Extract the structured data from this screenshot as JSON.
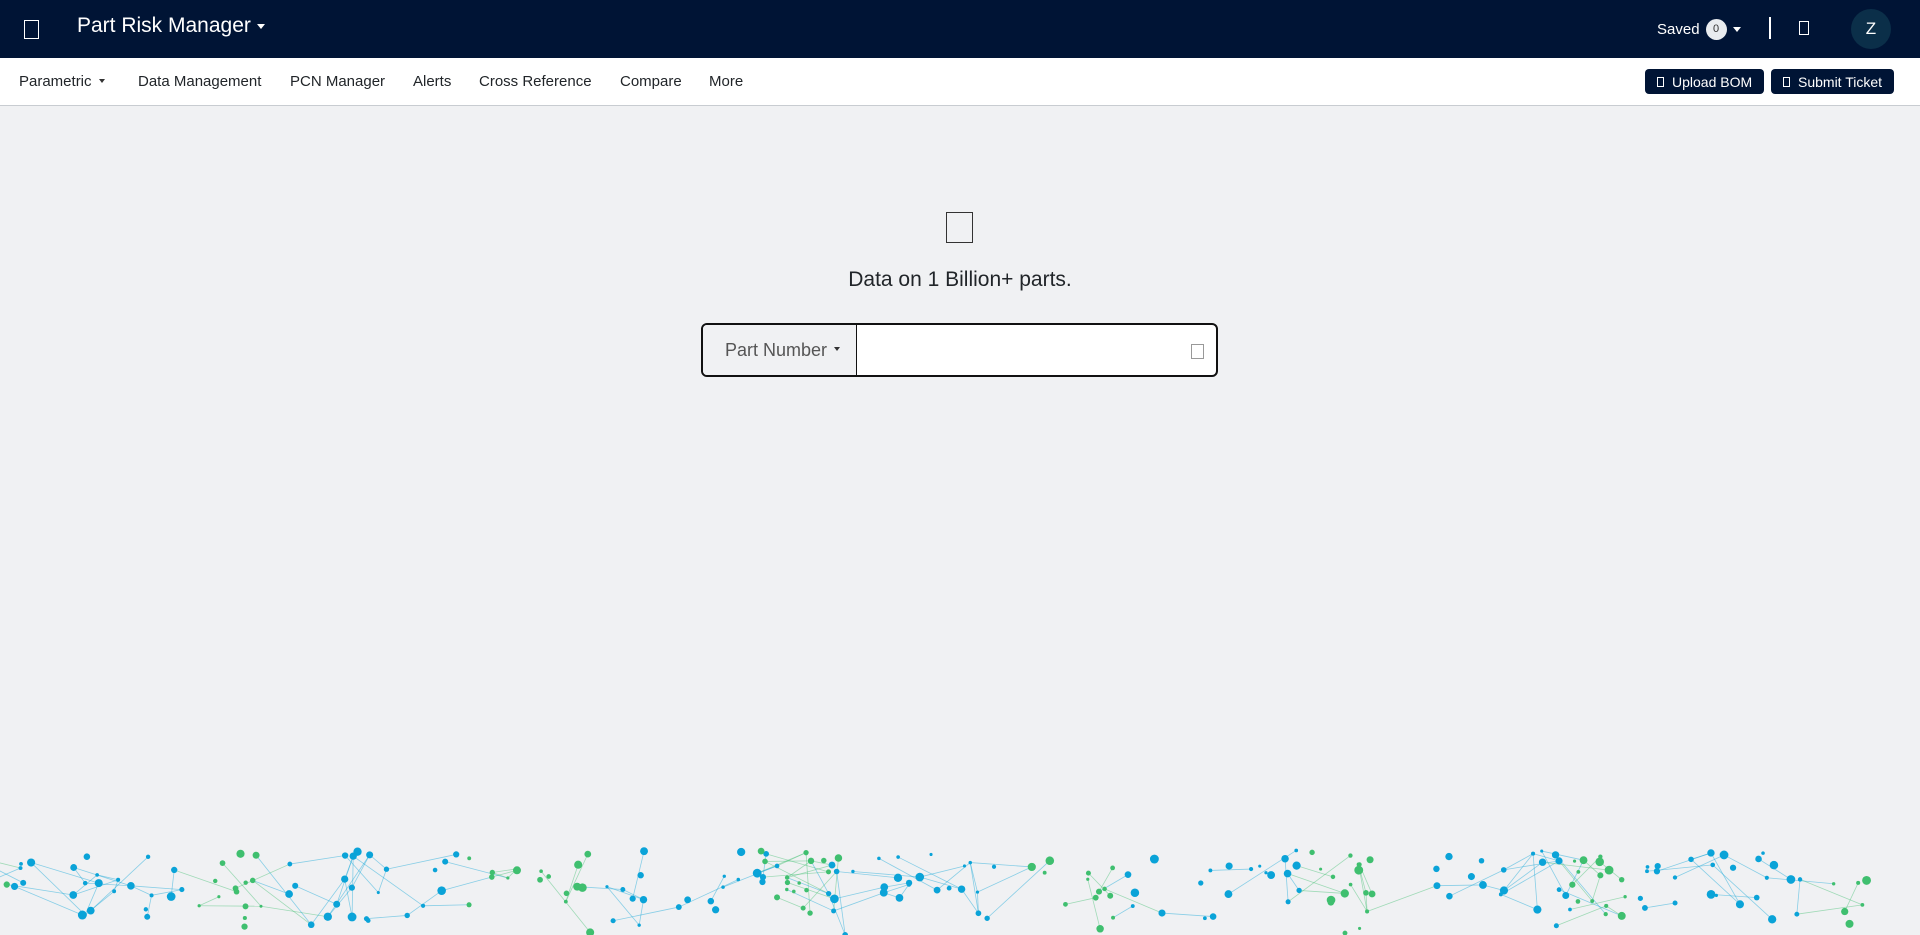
{
  "header": {
    "app_title": "Part Risk Manager",
    "saved_label": "Saved",
    "saved_count": "0",
    "avatar_initial": "Z"
  },
  "nav": {
    "items": [
      "Parametric",
      "Data Management",
      "PCN Manager",
      "Alerts",
      "Cross Reference",
      "Compare",
      "More"
    ],
    "upload_bom": "Upload BOM",
    "submit_ticket": "Submit Ticket"
  },
  "main": {
    "tagline": "Data on 1 Billion+ parts.",
    "search_type": "Part Number",
    "search_value": ""
  },
  "icons": {
    "menu": "menu-icon",
    "bell": "bell-icon",
    "upload": "upload-icon",
    "ticket": "ticket-icon",
    "hero": "database-icon",
    "search": "search-icon"
  },
  "colors": {
    "header_bg": "#001435",
    "page_bg": "#f0f1f3",
    "network_blue": "#0aa3d8",
    "network_green": "#3fbf6f"
  }
}
